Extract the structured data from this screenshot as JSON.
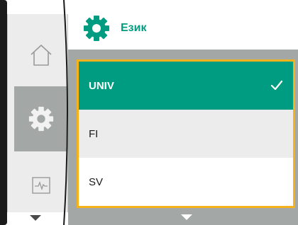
{
  "header": {
    "title": "Език",
    "icon": "gear-icon",
    "accent_color": "#009c82"
  },
  "sidebar": {
    "items": [
      {
        "id": "home",
        "icon": "home-icon",
        "selected": false
      },
      {
        "id": "settings",
        "icon": "gear-icon",
        "selected": true
      },
      {
        "id": "monitor",
        "icon": "pulse-monitor-icon",
        "selected": false
      }
    ],
    "scroll_icon": "chevron-down-icon"
  },
  "language_list": {
    "highlight_color": "#f5b21a",
    "items": [
      {
        "label": "UNIV",
        "selected": true
      },
      {
        "label": "FI",
        "selected": false
      },
      {
        "label": "SV",
        "selected": false
      }
    ],
    "scroll_icon": "chevron-down-icon",
    "check_icon": "checkmark-icon"
  }
}
